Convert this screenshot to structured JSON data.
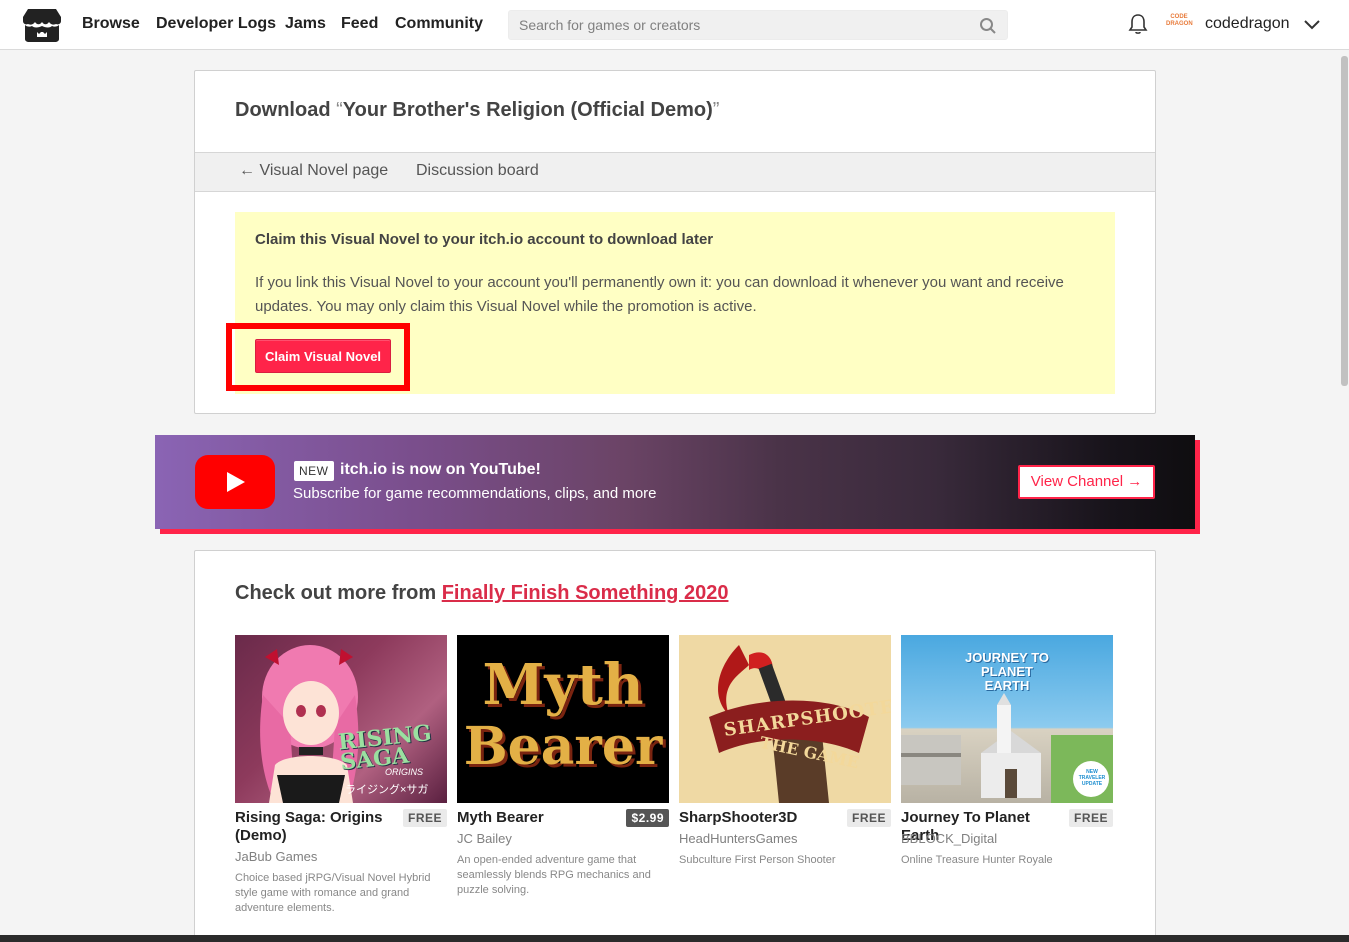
{
  "nav": {
    "links": [
      "Browse",
      "Developer Logs",
      "Jams",
      "Feed",
      "Community"
    ],
    "search_placeholder": "Search for games or creators",
    "avatar_text": "CODE DRAGON",
    "username": "codedragon"
  },
  "panel": {
    "title_prefix": "Download",
    "open_quote": "“",
    "game_name": "Your Brother's Religion (Official Demo)",
    "close_quote": "”",
    "subnav": {
      "back_arrow": "←",
      "visual_novel_page": "Visual Novel page",
      "discussion_board": "Discussion board"
    },
    "claim": {
      "title": "Claim this Visual Novel to your itch.io account to download later",
      "text": "If you link this Visual Novel to your account you'll permanently own it: you can download it whenever you want and receive updates. You may only claim this Visual Novel while the promotion is active.",
      "button": "Claim Visual Novel"
    }
  },
  "youtube_banner": {
    "new_tag": "NEW",
    "title": "itch.io is now on YouTube!",
    "subtitle": "Subscribe for game recommendations, clips, and more",
    "button": "View Channel →"
  },
  "more": {
    "title_prefix": "Check out more from",
    "jam_name": "Finally Finish Something 2020",
    "games": [
      {
        "title": "Rising Saga: Origins (Demo)",
        "price": "FREE",
        "author": "JaBub Games",
        "description": "Choice based jRPG/Visual Novel Hybrid style game with romance and grand adventure elements.",
        "thumb_text": "RISING SAGA",
        "thumb_sub": "ORIGINS",
        "thumb_jp": "ライジング×サガ"
      },
      {
        "title": "Myth Bearer",
        "price": "$2.99",
        "author": "JC Bailey",
        "description": "An open-ended adventure game that seamlessly blends RPG mechanics and puzzle solving.",
        "thumb_text": "Myth",
        "thumb_sub": "Bearer"
      },
      {
        "title": "SharpShooter3D",
        "price": "FREE",
        "author": "HeadHuntersGames",
        "description": "Subculture First Person Shooter",
        "thumb_text": "SHARPSHOOTER",
        "thumb_sub": "THE GAME"
      },
      {
        "title": "Journey To Planet Earth",
        "price": "FREE",
        "author": "BBLOCK_Digital",
        "description": "Online Treasure Hunter Royale",
        "thumb_text": "JOURNEY TO PLANET EARTH",
        "thumb_sub": "NEW TRAVELER UPDATE"
      }
    ]
  },
  "colors": {
    "accent": "#ff2449",
    "claim_bg": "#ffffc4",
    "highlight": "#ff0000",
    "link": "#da2c49"
  }
}
